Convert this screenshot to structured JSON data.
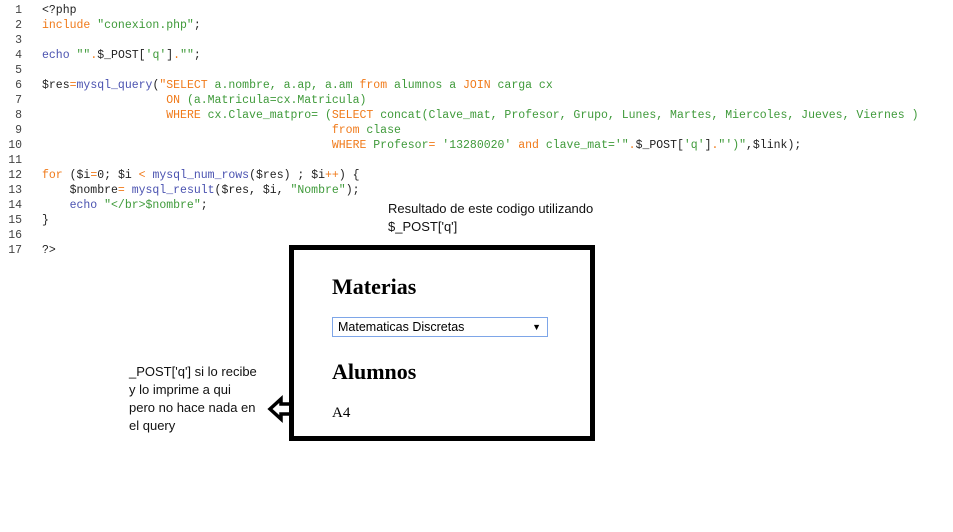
{
  "code": {
    "lines": [
      {
        "n": "1",
        "t": [
          [
            "d",
            "<?php"
          ]
        ]
      },
      {
        "n": "2",
        "t": [
          [
            "k",
            "include"
          ],
          [
            "s",
            " \"conexion.php\""
          ],
          [
            "d",
            ";"
          ]
        ]
      },
      {
        "n": "3",
        "t": []
      },
      {
        "n": "4",
        "t": [
          [
            "f",
            "echo"
          ],
          [
            "s",
            " \"\""
          ],
          [
            "k",
            "."
          ],
          [
            "d",
            "$_POST["
          ],
          [
            "s",
            "'q'"
          ],
          [
            "d",
            "]"
          ],
          [
            "k",
            "."
          ],
          [
            "s",
            "\"\""
          ],
          [
            "d",
            ";"
          ]
        ]
      },
      {
        "n": "5",
        "t": []
      },
      {
        "n": "6",
        "t": [
          [
            "d",
            "$res"
          ],
          [
            "k",
            "="
          ],
          [
            "f",
            "mysql_query"
          ],
          [
            "d",
            "("
          ],
          [
            "k",
            "\"SELECT"
          ],
          [
            "s",
            " a.nombre, a.ap, a.am "
          ],
          [
            "k",
            "from"
          ],
          [
            "s",
            " alumnos a "
          ],
          [
            "k",
            "JOIN"
          ],
          [
            "s",
            " carga cx"
          ]
        ]
      },
      {
        "n": "7",
        "t": [
          [
            "d",
            "                  "
          ],
          [
            "k",
            "ON"
          ],
          [
            "s",
            " (a.Matricula=cx.Matricula)"
          ]
        ]
      },
      {
        "n": "8",
        "t": [
          [
            "d",
            "                  "
          ],
          [
            "k",
            "WHERE"
          ],
          [
            "s",
            " cx.Clave_matpro= ("
          ],
          [
            "k",
            "SELECT"
          ],
          [
            "s",
            " concat(Clave_mat, Profesor, Grupo, Lunes, Martes, Miercoles, Jueves, Viernes )"
          ]
        ]
      },
      {
        "n": "9",
        "t": [
          [
            "d",
            "                                          "
          ],
          [
            "k",
            "from"
          ],
          [
            "s",
            " clase"
          ]
        ]
      },
      {
        "n": "10",
        "t": [
          [
            "d",
            "                                          "
          ],
          [
            "k",
            "WHERE"
          ],
          [
            "s",
            " Profesor"
          ],
          [
            "k",
            "="
          ],
          [
            "s",
            " '13280020' "
          ],
          [
            "k",
            "and"
          ],
          [
            "s",
            " clave_mat='\""
          ],
          [
            "k",
            "."
          ],
          [
            "d",
            "$_POST["
          ],
          [
            "s",
            "'q'"
          ],
          [
            "d",
            "]"
          ],
          [
            "k",
            "."
          ],
          [
            "s",
            "\"')\""
          ],
          [
            "d",
            ",$link);"
          ]
        ]
      },
      {
        "n": "11",
        "t": []
      },
      {
        "n": "12",
        "t": [
          [
            "k",
            "for"
          ],
          [
            "d",
            " ($i"
          ],
          [
            "k",
            "="
          ],
          [
            "d",
            "0; $i "
          ],
          [
            "k",
            "<"
          ],
          [
            "f",
            " mysql_num_rows"
          ],
          [
            "d",
            "($res) ; $i"
          ],
          [
            "k",
            "++"
          ],
          [
            "d",
            ") {"
          ]
        ]
      },
      {
        "n": "13",
        "t": [
          [
            "d",
            "    $nombre"
          ],
          [
            "k",
            "="
          ],
          [
            "f",
            " mysql_result"
          ],
          [
            "d",
            "($res, $i, "
          ],
          [
            "s",
            "\"Nombre\""
          ],
          [
            "d",
            ");"
          ]
        ]
      },
      {
        "n": "14",
        "t": [
          [
            "f",
            "    echo"
          ],
          [
            "s",
            " \"</br>$nombre\""
          ],
          [
            "d",
            ";"
          ]
        ]
      },
      {
        "n": "15",
        "t": [
          [
            "d",
            "}"
          ]
        ]
      },
      {
        "n": "16",
        "t": []
      },
      {
        "n": "17",
        "t": [
          [
            "d",
            "?>"
          ]
        ]
      }
    ]
  },
  "note_result": {
    "line1": "Resultado  de este codigo  utilizando",
    "line2": "$_POST['q']"
  },
  "note_left": {
    "line1": "_POST['q'] si lo recibe",
    "line2": "y lo imprime a qui",
    "line3": "pero no hace nada en",
    "line4": "el query"
  },
  "result": {
    "materias_heading": "Materias",
    "select_value": "Matematicas Discretas",
    "select_arrow": "▼",
    "alumnos_heading": "Alumnos",
    "alumno": "A4"
  },
  "icons": {
    "arrow": "arrow-left-outline-icon"
  }
}
